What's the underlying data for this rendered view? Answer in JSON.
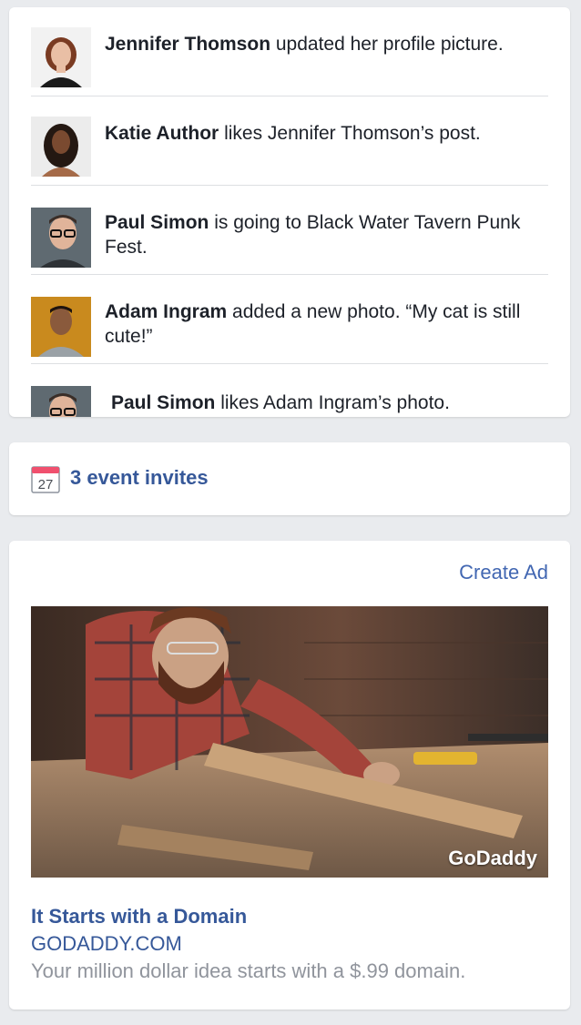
{
  "activity": {
    "items": [
      {
        "name": "Jennifer Thomson",
        "action": " updated her profile picture."
      },
      {
        "name": "Katie Author",
        "action": " likes Jennifer Thomson’s post."
      },
      {
        "name": "Paul Simon",
        "action": " is going to Black Water Tavern Punk Fest."
      },
      {
        "name": "Adam Ingram",
        "action": " added a new photo. “My cat is still cute!”"
      },
      {
        "name": "Paul Simon",
        "action": " likes Adam Ingram’s photo."
      }
    ]
  },
  "events": {
    "calendar_day": "27",
    "label": "3 event invites"
  },
  "ad": {
    "create_label": "Create Ad",
    "brand_logo": "GoDaddy",
    "title": "It Starts with a Domain",
    "domain": "GODADDY.COM",
    "description": "Your million dollar idea starts with a $.99 domain."
  },
  "colors": {
    "link": "#365899",
    "background": "#e9ebee",
    "muted": "#90949c"
  }
}
